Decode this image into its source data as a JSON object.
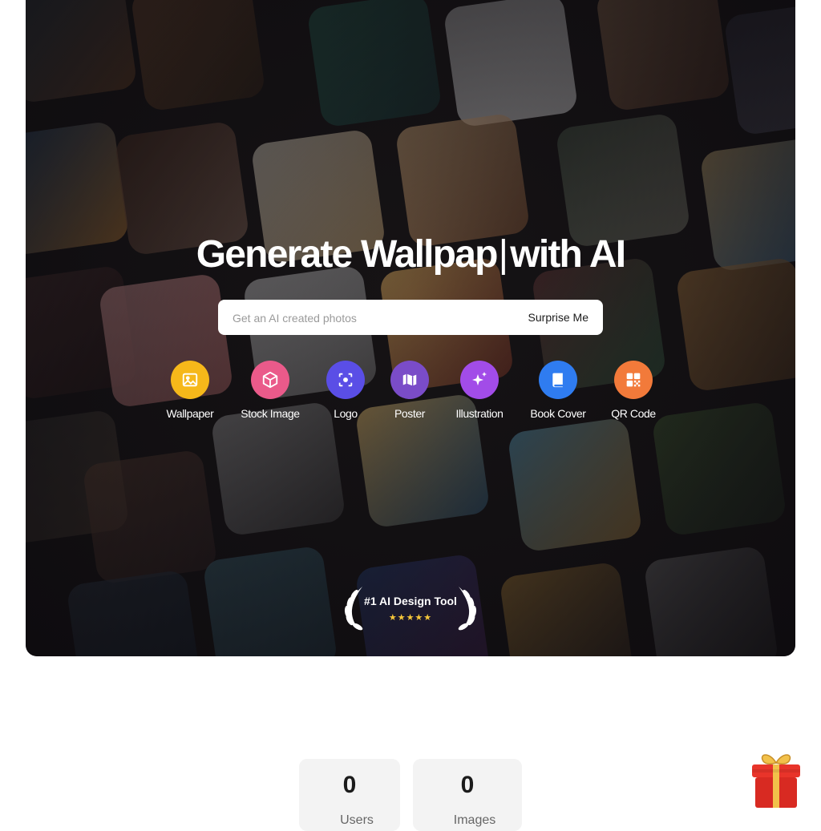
{
  "hero": {
    "headline_prefix": "Generate Wallpap",
    "headline_caret": "|",
    "headline_suffix": "with AI"
  },
  "search": {
    "placeholder": "Get an AI created photos",
    "value": "",
    "surprise_label": "Surprise Me"
  },
  "categories": [
    {
      "label": "Wallpaper",
      "icon": "image-icon",
      "color": "#f6b81a"
    },
    {
      "label": "Stock Image",
      "icon": "box-icon",
      "color": "#ea5a8a"
    },
    {
      "label": "Logo",
      "icon": "focus-icon",
      "color": "#5a4ee6"
    },
    {
      "label": "Poster",
      "icon": "map-icon",
      "color": "#7a4cc8"
    },
    {
      "label": "Illustration",
      "icon": "sparkles-icon",
      "color": "#a24ce8"
    },
    {
      "label": "Book Cover",
      "icon": "book-icon",
      "color": "#2f7cf0"
    },
    {
      "label": "QR Code",
      "icon": "qr-code-icon",
      "color": "#f27a3a"
    }
  ],
  "award": {
    "title": "#1 AI Design Tool",
    "rating": 5,
    "stars": "★★★★★",
    "icon": "laurel-wreath-icon"
  },
  "stats": [
    {
      "value": "0",
      "label": "Users"
    },
    {
      "value": "0",
      "label": "Images"
    }
  ],
  "gift": {
    "icon": "gift-icon"
  }
}
